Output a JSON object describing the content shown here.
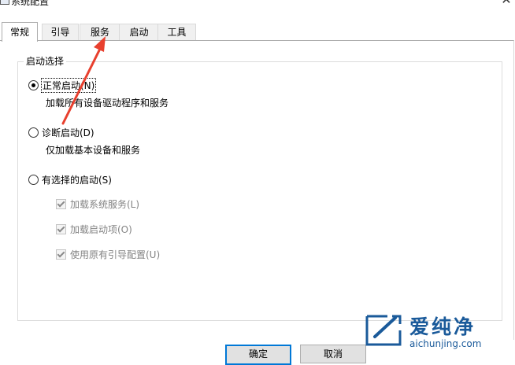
{
  "window": {
    "title": "系统配置",
    "close_glyph": "✕"
  },
  "tabs": [
    {
      "label": "常规",
      "active": true
    },
    {
      "label": "引导",
      "active": false
    },
    {
      "label": "服务",
      "active": false
    },
    {
      "label": "启动",
      "active": false
    },
    {
      "label": "工具",
      "active": false
    }
  ],
  "startup_group": {
    "legend": "启动选择",
    "options": [
      {
        "label": "正常启动(N)",
        "description": "加载所有设备驱动程序和服务",
        "selected": true
      },
      {
        "label": "诊断启动(D)",
        "description": "仅加载基本设备和服务",
        "selected": false
      },
      {
        "label": "有选择的启动(S)",
        "selected": false
      }
    ],
    "selective_items": [
      {
        "label": "加载系统服务(L)",
        "checked": true,
        "enabled": false
      },
      {
        "label": "加载启动项(O)",
        "checked": true,
        "enabled": false
      },
      {
        "label": "使用原有引导配置(U)",
        "checked": true,
        "enabled": false
      }
    ]
  },
  "buttons": {
    "ok": "确定",
    "cancel": "取消"
  },
  "annotation": {
    "color": "#e8402e",
    "points_to": "服务"
  },
  "watermark": {
    "brand": "爱纯净",
    "url": "aichunjing.com",
    "color": "#1a5a9a"
  }
}
